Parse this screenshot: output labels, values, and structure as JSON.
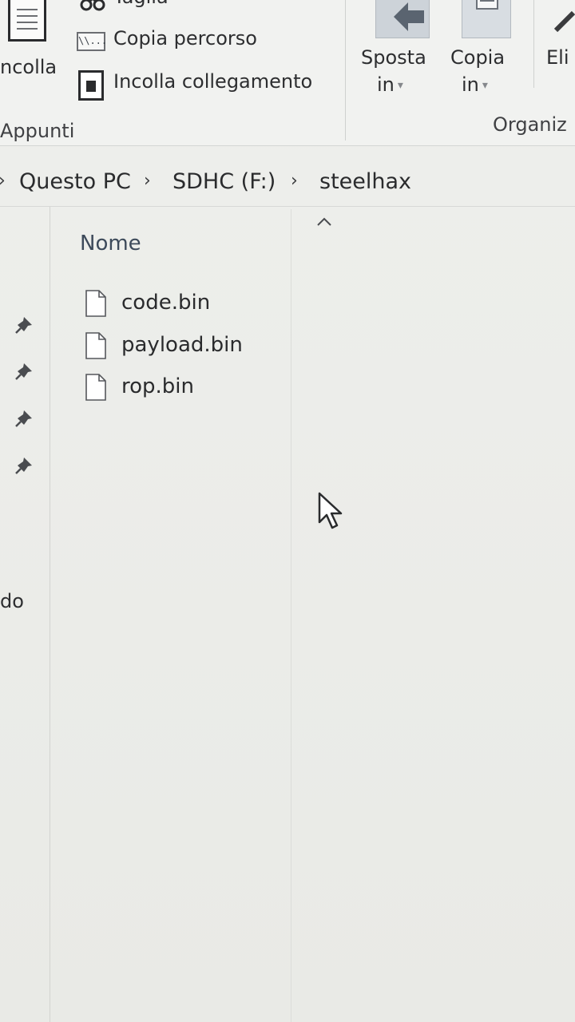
{
  "ribbon": {
    "clipboard_group": {
      "paste_label": "ncolla",
      "cut_label": "Taglia",
      "copy_path_label": "Copia percorso",
      "copy_path_icon_text": "\\\\...",
      "paste_shortcut_label": "Incolla collegamento",
      "group_label": "Appunti"
    },
    "organize_group": {
      "move_to_line1": "Sposta",
      "move_to_line2": "in",
      "copy_to_line1": "Copia",
      "copy_to_line2": "in",
      "delete_label": "Eli",
      "group_label": "Organiz"
    }
  },
  "breadcrumb": {
    "items": [
      "Questo PC",
      "SDHC (F:)",
      "steelhax"
    ],
    "separator": "›"
  },
  "nav_pane": {
    "pinned_count": 4,
    "visible_text": "do"
  },
  "file_list": {
    "column_header": "Nome",
    "sort": "ascending",
    "files": [
      {
        "name": "code.bin"
      },
      {
        "name": "payload.bin"
      },
      {
        "name": "rop.bin"
      }
    ]
  },
  "icons": {
    "paste": "clipboard-paste-icon",
    "cut": "scissors-icon",
    "copy_path": "copy-path-icon",
    "paste_shortcut": "paste-shortcut-icon",
    "move_to": "move-to-icon",
    "copy_to": "copy-to-icon",
    "pin": "pin-icon",
    "file": "file-icon",
    "cursor": "mouse-cursor-icon"
  },
  "colors": {
    "background": "#ecedea",
    "ribbon_background": "#f1f2f0",
    "text": "#2c2d2f",
    "header_text": "#3d4a5a"
  }
}
